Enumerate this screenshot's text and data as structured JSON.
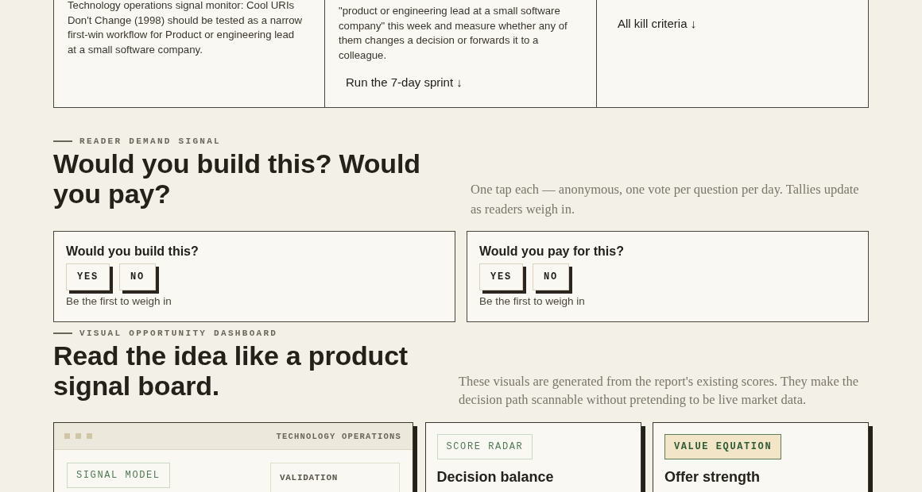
{
  "top_cards": [
    {
      "text": "Technology operations signal monitor: Cool URIs Don't Change (1998) should be tested as a narrow first-win workflow for Product or engineering lead at a small software company."
    },
    {
      "text": "\"product or engineering lead at a small software company\" this week and measure whether any of them changes a decision or forwards it to a colleague.",
      "link": "Run the 7-day sprint ↓"
    },
    {
      "link": "All kill criteria ↓"
    }
  ],
  "reader_demand": {
    "eyebrow": "READER DEMAND SIGNAL",
    "title": "Would you build this? Would you pay?",
    "intro": "One tap each — anonymous, one vote per question per day. Tallies update as readers weigh in.",
    "polls": [
      {
        "question": "Would you build this?",
        "options": [
          {
            "label": "YES",
            "selected": false
          },
          {
            "label": "NO",
            "selected": false
          }
        ],
        "status": "Be the first to weigh in"
      },
      {
        "question": "Would you pay for this?",
        "options": [
          {
            "label": "YES",
            "selected": false
          },
          {
            "label": "NO",
            "selected": false
          }
        ],
        "status": "Be the first to weigh in"
      }
    ]
  },
  "dashboard": {
    "eyebrow": "VISUAL OPPORTUNITY DASHBOARD",
    "title": "Read the idea like a product signal board.",
    "intro": "These visuals are generated from the report's existing scores. They make the decision path scannable without pretending to be live market data.",
    "panels": [
      {
        "kind": "signal",
        "header": "TECHNOLOGY OPERATIONS",
        "tag": {
          "label": "SIGNAL MODEL",
          "highlighted": false
        },
        "metric_label": "VALIDATION"
      },
      {
        "kind": "radar",
        "tag": {
          "label": "SCORE RADAR",
          "highlighted": false
        },
        "title": "Decision balance"
      },
      {
        "kind": "equation",
        "tag": {
          "label": "VALUE EQUATION",
          "highlighted": true
        },
        "title": "Offer strength"
      }
    ]
  }
}
